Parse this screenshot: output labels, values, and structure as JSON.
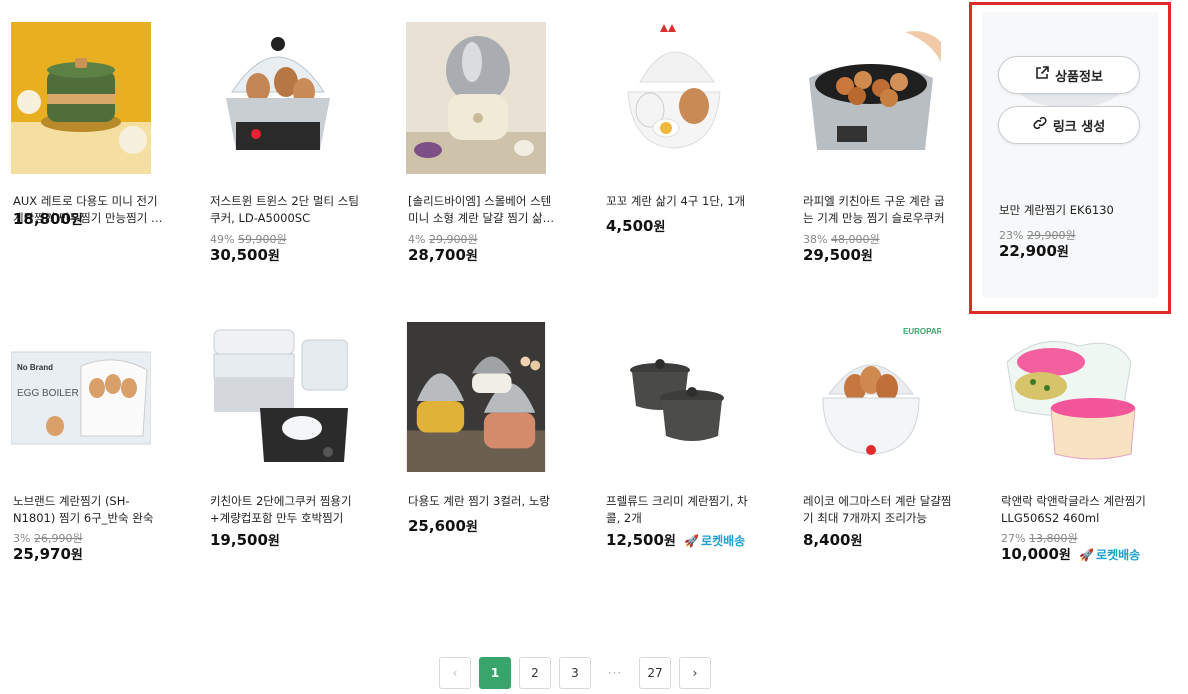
{
  "row1": [
    {
      "title": "AUX 레트로 다용도 미니 전기 계란찜기 만두찜기 만능찜기 에그쿠커",
      "discount": "",
      "orig": "",
      "price": "18,800",
      "won": "원",
      "rocket": ""
    },
    {
      "title": "저스트윈 트윈스 2단 멀티 스팀 쿠커, LD-A5000SC",
      "discount": "49%",
      "orig": "59,900원",
      "price": "30,500",
      "won": "원",
      "rocket": ""
    },
    {
      "title": "[솔리드바이엠] 스몰베어 스텐 미니 소형 계란 달걀 찜기 삶는기계",
      "discount": "4%",
      "orig": "29,900원",
      "price": "28,700",
      "won": "원",
      "rocket": ""
    },
    {
      "title": "꼬꼬 계란 삶기 4구 1단, 1개",
      "discount": "",
      "orig": "",
      "price": "4,500",
      "won": "원",
      "rocket": ""
    },
    {
      "title": "라피엘 키친아트 구운 계란 굽는 기계 만능 찜기 슬로우쿠커",
      "discount": "38%",
      "orig": "48,000원",
      "price": "29,500",
      "won": "원",
      "rocket": ""
    }
  ],
  "highlight": {
    "btn_info": "상품정보",
    "btn_link": "링크 생성",
    "title": "보만 계란찜기 EK6130",
    "discount": "23%",
    "orig": "29,900원",
    "price": "22,900",
    "won": "원"
  },
  "row2": [
    {
      "title": "노브랜드 계란찜기 (SH-N1801) 찜기 6구_반숙 완숙",
      "discount": "3%",
      "orig": "26,990원",
      "price": "25,970",
      "won": "원",
      "rocket": ""
    },
    {
      "title": "키친아트 2단에그쿠커 찜용기 +계량컵포함 만두 호박찜기",
      "discount": "",
      "orig": "",
      "price": "19,500",
      "won": "원",
      "rocket": ""
    },
    {
      "title": "다용도 계란 찜기 3컬러, 노랑",
      "discount": "",
      "orig": "",
      "price": "25,600",
      "won": "원",
      "rocket": ""
    },
    {
      "title": "프렐류드 크리미 계란찜기, 차콜, 2개",
      "discount": "",
      "orig": "",
      "price": "12,500",
      "won": "원",
      "rocket": "로켓배송"
    },
    {
      "title": "레이코 에그마스터 계란 달걀찜기 최대 7개까지 조리가능",
      "discount": "",
      "orig": "",
      "price": "8,400",
      "won": "원",
      "rocket": ""
    },
    {
      "title": "락앤락 락앤락글라스 계란찜기 LLG506S2 460ml",
      "discount": "27%",
      "orig": "13,800원",
      "price": "10,000",
      "won": "원",
      "rocket": "로켓배송"
    }
  ],
  "pagination": {
    "prev": "‹",
    "pages": [
      "1",
      "2",
      "3"
    ],
    "dots": "···",
    "last": "27",
    "next": "›"
  },
  "image_text": {
    "brand_europark": "EUROPARK",
    "nobrand": "No Brand",
    "egg_boiler": "EGG BOILER"
  },
  "colors": {
    "accent_green": "#3aa56a",
    "highlight_red": "#e02b2b",
    "rocket_blue": "#1b9fd1"
  }
}
